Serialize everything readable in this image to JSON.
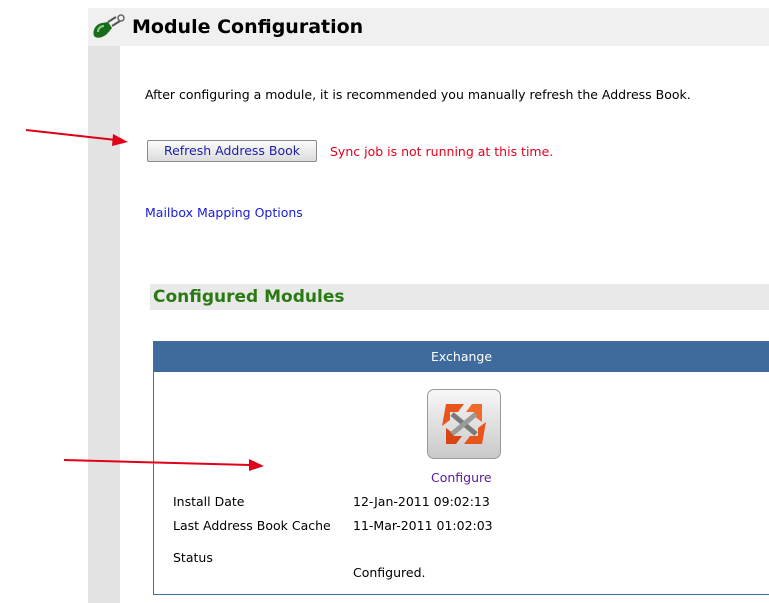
{
  "header": {
    "title": "Module Configuration",
    "icon": "plug-icon"
  },
  "intro_text": "After configuring a module, it is recommended you manually refresh the Address Book.",
  "refresh_button_label": "Refresh Address Book",
  "sync_status": "Sync job is not running at this time.",
  "mailbox_link": "Mailbox Mapping Options",
  "configured_modules": {
    "title": "Configured Modules",
    "module": {
      "name": "Exchange",
      "icon": "exchange-icon",
      "configure_label": "Configure",
      "fields": {
        "install_date_label": "Install Date",
        "install_date_value": "12-Jan-2011 09:02:13",
        "cache_label": "Last Address Book Cache",
        "cache_value": "11-Mar-2011 01:02:03",
        "status_label": "Status",
        "status_value": "Configured."
      }
    }
  },
  "colors": {
    "module_header": "#3e6b9b",
    "section_title": "#2a7a14",
    "status_error": "#e3001b",
    "annotation_arrow": "#e0001a"
  }
}
